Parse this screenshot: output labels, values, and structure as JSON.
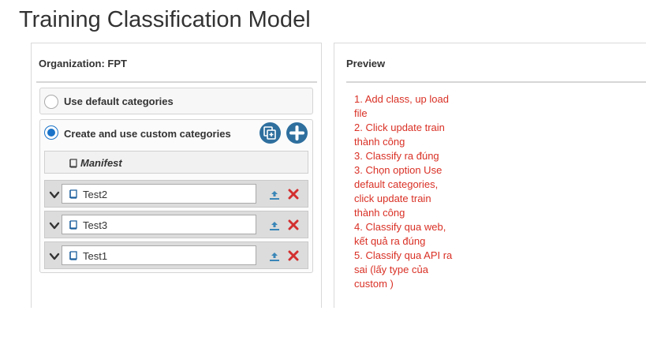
{
  "page": {
    "title": "Training Classification Model"
  },
  "left_panel": {
    "header": "Organization: FPT",
    "options": {
      "default_label": "Use default categories",
      "custom_label": "Create and use custom categories"
    },
    "manifest_label": "Manifest",
    "classes": [
      {
        "name": "Test2"
      },
      {
        "name": "Test3"
      },
      {
        "name": "Test1"
      }
    ],
    "icons": {
      "copy_add": "copy-plus-icon",
      "add": "plus-circle-icon",
      "book": "book-icon",
      "chevron": "chevron-down-icon",
      "upload": "upload-icon",
      "delete": "close-icon"
    }
  },
  "right_panel": {
    "header": "Preview",
    "notes": [
      "1. Add class, up load",
      "file",
      "2. Click update train",
      "thành công",
      "3. Classify ra đúng",
      "3. Chọn option Use",
      "default categories,",
      "click update train",
      "thành công",
      "4. Classify qua web,",
      "kết quả ra đúng",
      "5. Classify qua API ra",
      "sai (lấy  type của",
      "custom )"
    ]
  },
  "colors": {
    "accent": "#1a73c8",
    "circle_button": "#2e6f9e",
    "delete": "#d32f2f",
    "upload": "#3a86b8",
    "notes_text": "#d93025"
  },
  "selected_option": "custom"
}
